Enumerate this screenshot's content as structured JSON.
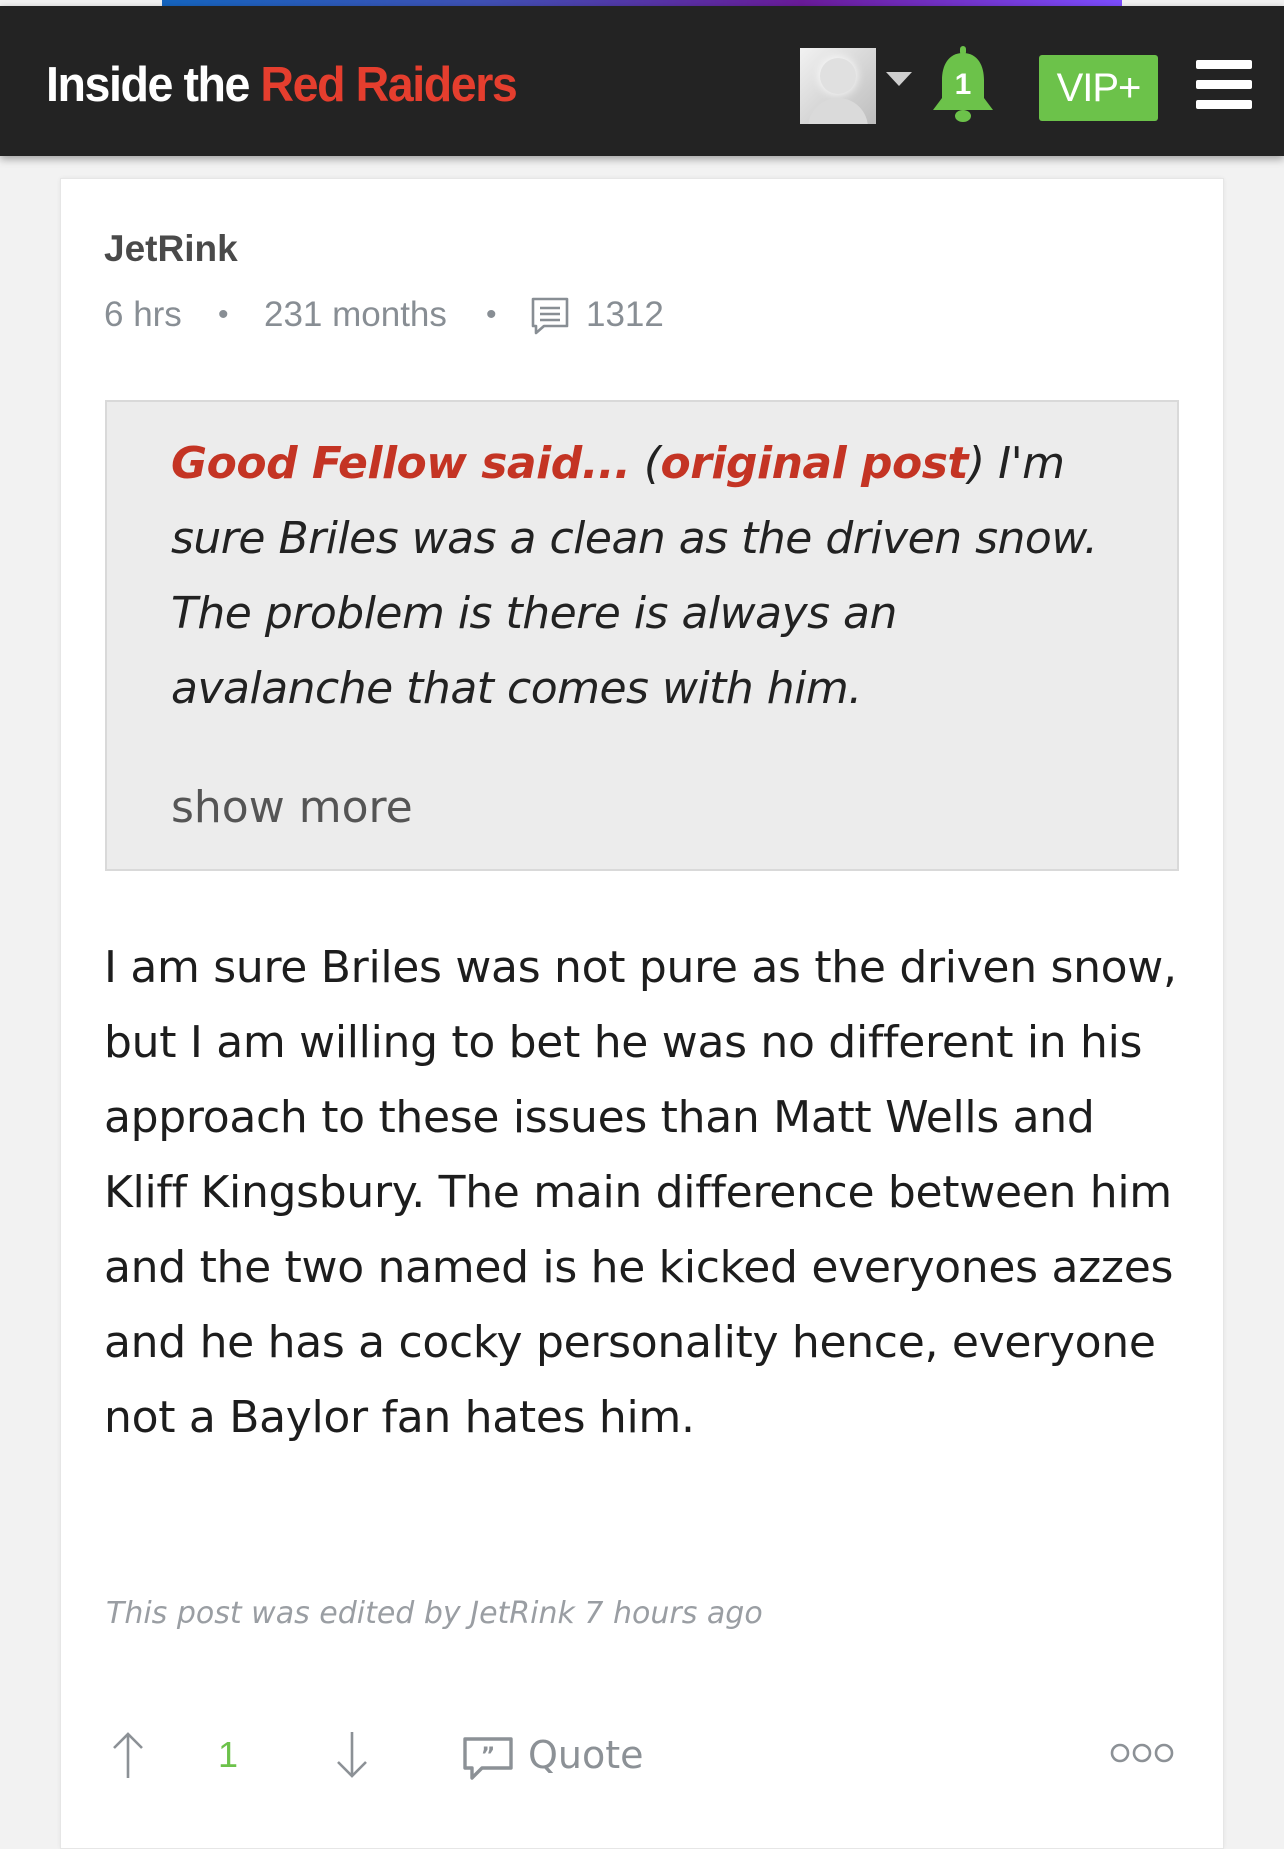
{
  "header": {
    "brand_white": "Inside the",
    "brand_red": "Red Raiders",
    "notification_count": "1",
    "vip_label": "VIP+"
  },
  "post": {
    "author": "JetRink",
    "time_ago": "6 hrs",
    "member_since": "231 months",
    "post_count": "1312",
    "quote": {
      "author_link": "Good Fellow said...",
      "open_paren": " (",
      "original_link": "original post",
      "text": ") I'm sure Briles was a clean as the driven snow. The problem is there is always an avalanche that comes with him.",
      "show_more": "show more"
    },
    "body": "I am sure Briles was not pure as the driven snow, but I am willing to bet he was no different in his approach to these issues than Matt Wells and Kliff Kingsbury. The main difference between him and the two named is he kicked everyones azzes and he has a cocky personality hence, everyone not a Baylor fan hates him.",
    "edited_note": "This post was edited by JetRink 7 hours ago",
    "actions": {
      "vote_count": "1",
      "quote_label": "Quote"
    }
  },
  "colors": {
    "navbar": "#232323",
    "brand_red": "#e53e2e",
    "accent_green": "#6cc24a",
    "quote_link": "#c43424"
  },
  "icons": [
    "avatar",
    "caret-down-icon",
    "bell-icon",
    "hamburger-menu-icon",
    "post-count-icon",
    "upvote-arrow-icon",
    "downvote-arrow-icon",
    "quote-icon",
    "more-options-icon"
  ]
}
